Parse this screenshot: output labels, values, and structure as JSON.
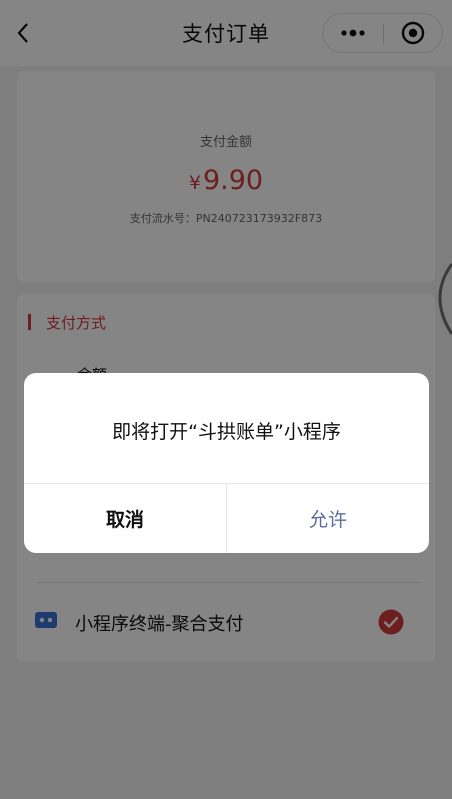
{
  "header": {
    "title": "支付订单"
  },
  "payment": {
    "amount_label": "支付金额",
    "currency": "¥",
    "amount": "9.90",
    "serial": "支付流水号：PN240723173932F873"
  },
  "methods": {
    "title": "支付方式",
    "partial_row_label": "余额",
    "selected_label": "小程序终端-聚合支付"
  },
  "dialog": {
    "message": "即将打开“斗拱账单”小程序",
    "cancel_label": "取消",
    "allow_label": "允许"
  },
  "colors": {
    "accent": "#d23a3a",
    "allow": "#5a6e9c",
    "method_icon": "#3d6fd1"
  },
  "icons": [
    "chevron-left-icon",
    "more-dots-icon",
    "target-close-icon",
    "card-icon",
    "check-circle-icon"
  ]
}
